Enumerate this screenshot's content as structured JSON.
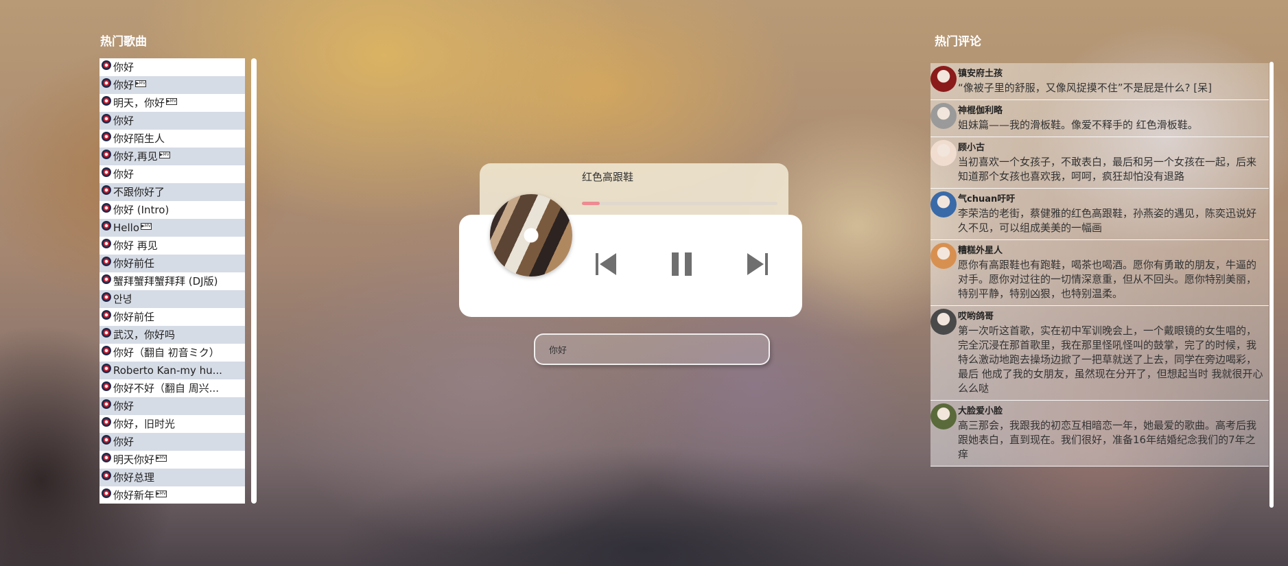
{
  "songs_section": {
    "title": "热门歌曲",
    "items": [
      {
        "label": "你好",
        "mv": false
      },
      {
        "label": "你好",
        "mv": true
      },
      {
        "label": "明天，你好",
        "mv": true
      },
      {
        "label": "你好",
        "mv": false
      },
      {
        "label": "你好陌生人",
        "mv": false
      },
      {
        "label": "你好,再见",
        "mv": true
      },
      {
        "label": "你好",
        "mv": false
      },
      {
        "label": "不跟你好了",
        "mv": false
      },
      {
        "label": "你好 (Intro)",
        "mv": false
      },
      {
        "label": "Hello",
        "mv": true
      },
      {
        "label": "你好 再见",
        "mv": false
      },
      {
        "label": "你好前任",
        "mv": false
      },
      {
        "label": "蟹拜蟹拜蟹拜拜 (DJ版)",
        "mv": false
      },
      {
        "label": "안녕",
        "mv": false
      },
      {
        "label": "你好前任",
        "mv": false
      },
      {
        "label": "武汉，你好吗",
        "mv": false
      },
      {
        "label": "你好（翻自 初音ミク）",
        "mv": false
      },
      {
        "label": "Roberto Kan-my hu...",
        "mv": false
      },
      {
        "label": "你好不好（翻自 周兴...",
        "mv": false
      },
      {
        "label": "你好",
        "mv": false
      },
      {
        "label": "你好，旧时光",
        "mv": false
      },
      {
        "label": "你好",
        "mv": false
      },
      {
        "label": "明天你好",
        "mv": true
      },
      {
        "label": "你好总理",
        "mv": false
      },
      {
        "label": "你好新年",
        "mv": true
      }
    ]
  },
  "player": {
    "song_name": "红色高跟鞋",
    "progress": 0.09,
    "progress_color": "#ee8a92",
    "controls": [
      "skip-previous-icon",
      "pause-icon",
      "skip-next-icon"
    ]
  },
  "search": {
    "value": "你好"
  },
  "comments_section": {
    "title": "热门评论",
    "items": [
      {
        "user": "镇安府土孩",
        "text": "“像被子里的舒服，又像风捉摸不住”不是屁是什么? [呆]",
        "avatar_color": "#8b1a1a"
      },
      {
        "user": "神棍伽利略",
        "text": "姐妹篇——我的滑板鞋。像爱不释手的 红色滑板鞋。",
        "avatar_color": "#9a9a9a"
      },
      {
        "user": "顾小古",
        "text": "当初喜欢一个女孩子，不敢表白，最后和另一个女孩在一起，后来知道那个女孩也喜欢我，呵呵，疯狂却怕没有退路",
        "avatar_color": "#f0ddd0"
      },
      {
        "user": "气chuan吁吁",
        "text": "李荣浩的老街，蔡健雅的红色高跟鞋，孙燕姿的遇见，陈奕迅说好久不见，可以组成美美的一幅画",
        "avatar_color": "#3a6aa8"
      },
      {
        "user": "糟糕外星人",
        "text": "愿你有高跟鞋也有跑鞋，喝茶也喝酒。愿你有勇敢的朋友，牛逼的对手。愿你对过往的一切情深意重，但从不回头。愿你特别美丽，特别平静，特别凶狠，也特别温柔。",
        "avatar_color": "#d89050"
      },
      {
        "user": "哎哟鸽哥",
        "text": "第一次听这首歌，实在初中军训晚会上，一个戴眼镜的女生唱的，完全沉浸在那首歌里，我在那里怪吼怪叫的鼓掌，完了的时候，我特么激动地跑去操场边掀了一把草就送了上去，同学在旁边喝彩，最后 他成了我的女朋友，虽然现在分开了，但想起当时 我就很开心 么么哒",
        "avatar_color": "#4a4a4a"
      },
      {
        "user": "大脸爱小脸",
        "text": "高三那会，我跟我的初恋互相暗恋一年，她最爱的歌曲。高考后我跟她表白，直到现在。我们很好，准备16年结婚纪念我们的7年之痒",
        "avatar_color": "#5a6a3a"
      }
    ]
  }
}
